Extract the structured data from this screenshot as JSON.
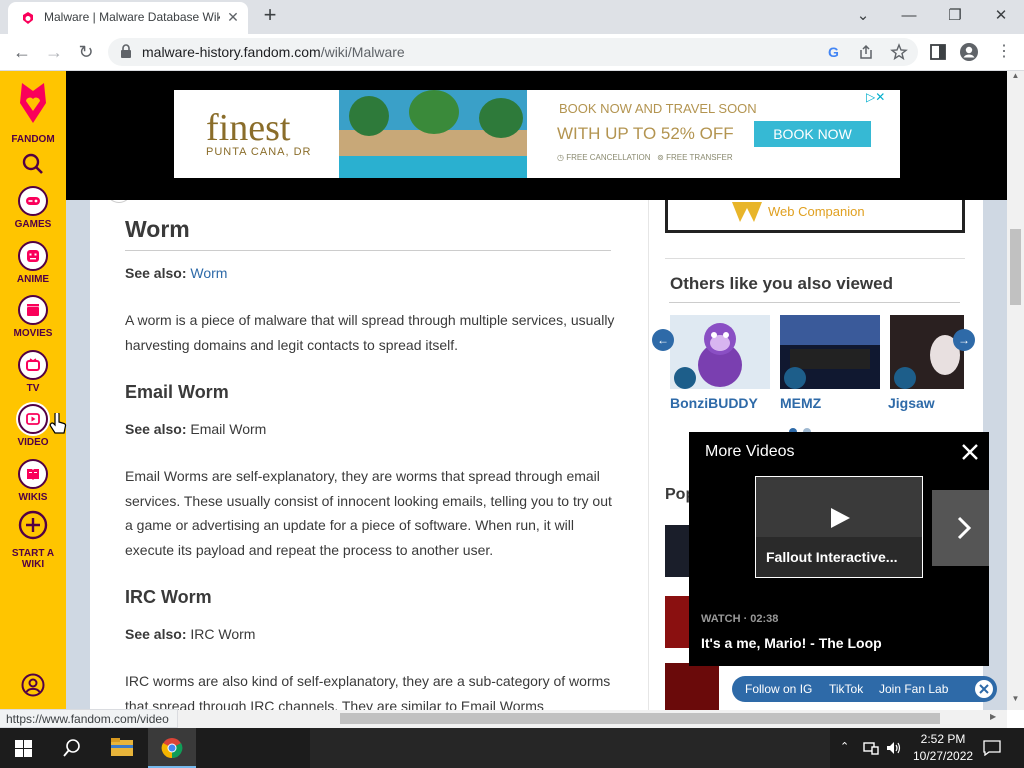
{
  "browser": {
    "tab_title": "Malware | Malware Database Wiki",
    "url_host": "malware-history.fandom.com",
    "url_path": "/wiki/Malware",
    "status_url": "https://www.fandom.com/video"
  },
  "sidebar": {
    "brand": "FANDOM",
    "items": [
      {
        "label": "GAMES"
      },
      {
        "label": "ANIME"
      },
      {
        "label": "MOVIES"
      },
      {
        "label": "TV"
      },
      {
        "label": "VIDEO"
      },
      {
        "label": "WIKIS"
      },
      {
        "label": "START A WIKI"
      }
    ]
  },
  "ad": {
    "brand": "finest",
    "brand_sub": "PUNTA CANA, DR",
    "headline": "BOOK NOW AND TRAVEL SOON",
    "offer": "WITH UP TO 52% OFF",
    "cta": "BOOK NOW",
    "perk1": "FREE CANCELLATION",
    "perk2": "FREE TRANSFER"
  },
  "article": {
    "sections": [
      {
        "heading": "Worm",
        "see_also_label": "See also:",
        "see_also_value": "Worm",
        "body": "A worm is a piece of malware that will spread through multiple services, usually harvesting domains and legit contacts to spread itself."
      },
      {
        "heading": "Email Worm",
        "see_also_label": "See also:",
        "see_also_value": "Email Worm",
        "body": "Email Worms are self-explanatory, they are worms that spread through email services. These usually consist of innocent looking emails, telling you to try out a game or advertising an update for a piece of software. When run, it will execute its payload and repeat the process to another user."
      },
      {
        "heading": "IRC Worm",
        "see_also_label": "See also:",
        "see_also_value": "IRC Worm",
        "body": "IRC worms are also kind of self-explanatory, they are a sub-category of worms that spread through IRC channels. They are similar to Email Worms"
      }
    ]
  },
  "rail": {
    "companion": "Web Companion",
    "others_title": "Others like you also viewed",
    "others": [
      {
        "label": "BonziBUDDY"
      },
      {
        "label": "MEMZ"
      },
      {
        "label": "Jigsaw"
      }
    ],
    "popular_title": "Pop"
  },
  "video": {
    "title": "More Videos",
    "thumb_caption": "Fallout Interactive...",
    "watch_meta": "WATCH · 02:38",
    "watch_title": "It's a me, Mario! - The Loop"
  },
  "social": {
    "ig": "Follow on IG",
    "tiktok": "TikTok",
    "fanlab": "Join Fan Lab"
  },
  "taskbar": {
    "time": "2:52 PM",
    "date": "10/27/2022"
  }
}
